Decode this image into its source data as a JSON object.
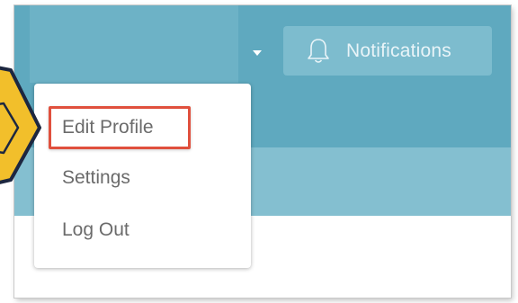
{
  "header": {
    "notifications_label": "Notifications",
    "notifications_icon": "bell-icon",
    "user_menu_icon": "caret-down-icon"
  },
  "dropdown": {
    "items": [
      {
        "label": "Edit Profile",
        "highlighted": true
      },
      {
        "label": "Settings",
        "highlighted": false
      },
      {
        "label": "Log Out",
        "highlighted": false
      }
    ]
  },
  "colors": {
    "header_bg": "#5fa9bf",
    "user_block_bg": "#6db2c6",
    "notifications_bg": "#7dbcce",
    "subheader_bg": "#84bfd0",
    "highlight": "#e0503d",
    "star_fill": "#f2bf2b",
    "star_outline": "#1d2740",
    "menu_text": "#6b6b6b"
  }
}
